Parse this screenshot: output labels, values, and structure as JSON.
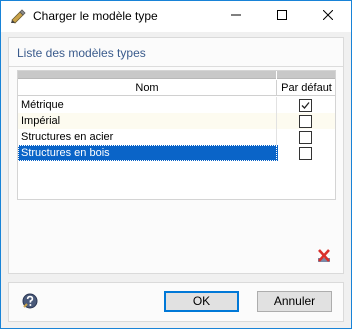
{
  "window": {
    "title": "Charger le modèle type",
    "controls": [
      "minimize-icon",
      "maximize-icon",
      "close-icon"
    ]
  },
  "group": {
    "title": "Liste des modèles types"
  },
  "table": {
    "columns": [
      "Nom",
      "Par défaut"
    ],
    "rows": [
      {
        "name": "Métrique",
        "default": true
      },
      {
        "name": "Impérial",
        "default": false
      },
      {
        "name": "Structures en acier",
        "default": false
      },
      {
        "name": "Structures en bois",
        "default": false,
        "selected": true
      }
    ]
  },
  "buttons": {
    "ok": "OK",
    "cancel": "Annuler"
  },
  "icons": {
    "app": "template-load-icon",
    "delete": "delete-icon",
    "help": "help-icon"
  },
  "colors": {
    "accent": "#0a64c8",
    "group_title": "#3a5b8c",
    "delete_red": "#d9302b"
  }
}
